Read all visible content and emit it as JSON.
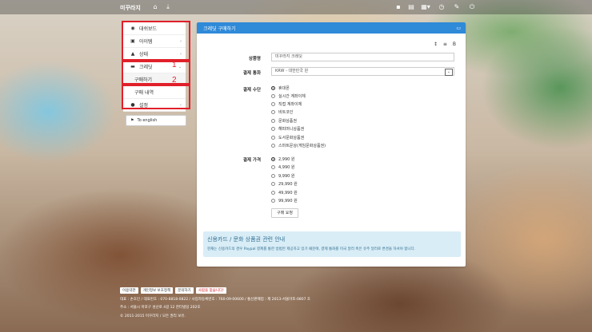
{
  "navbar": {
    "brand": "미꾸라지",
    "icons_left": [
      "home-icon",
      "download-icon"
    ],
    "icons_right": [
      "chat-icon",
      "document-icon",
      "grid-menu-icon",
      "clock-icon",
      "pencil-icon",
      "power-icon"
    ]
  },
  "sidebar": {
    "items": [
      {
        "icon": "dashboard-icon",
        "label": "대쉬보드"
      },
      {
        "icon": "item-icon",
        "label": "아이템",
        "chev": "‹"
      },
      {
        "icon": "status-icon",
        "label": "상태",
        "chev": "‹"
      },
      {
        "icon": "credit-icon",
        "label": "크레딧",
        "chev": "⌄"
      },
      {
        "label": "구매하기"
      },
      {
        "label": "구매 내역"
      },
      {
        "icon": "user-icon",
        "label": "설정",
        "chev": "‹"
      }
    ],
    "annotations": [
      "1",
      "2"
    ],
    "lang_button": "To english"
  },
  "panel": {
    "title": "크레딧 구매하기",
    "toolbar": [
      "↕",
      "≡",
      "B"
    ],
    "form": {
      "product_label": "상품명",
      "product_value": "미꾸라지 크레딧",
      "currency_label": "결제 통화",
      "currency_value": "KRW - 대한민국 원",
      "method_label": "결제 수단",
      "methods": [
        "휴대폰",
        "실시간 계좌이체",
        "직접 계좌이체",
        "비트코인",
        "문화상품권",
        "해피머니상품권",
        "도서문화상품권",
        "스마트문상(게임문화상품권)"
      ],
      "selected_method": 0,
      "price_label": "결제 가격",
      "prices": [
        "2,990 원",
        "4,990 원",
        "9,990 원",
        "29,990 원",
        "49,990 원",
        "99,990 원"
      ],
      "selected_price": 0,
      "submit_label": "구매 요청"
    },
    "notice": {
      "title": "신용카드 / 문화 상품권 관련 안내",
      "body": "현재는 신용카드의 경우 Paypal 결제를 통한 방법만 제공하고 있기 때문에, 결제 통화를 미국 달러 혹은 유주 달러로 변경을 하셔야 합니다."
    }
  },
  "footer": {
    "links": [
      "이용약관",
      "개인정보 보호정책",
      "문의하기",
      "사람을 찾습니다!"
    ],
    "lines": [
      "대표 : 손호인 / 대표번호 : 070-8818-0822 / 사업자등록번호 : 760-09-00600 / 통신판매업 : 제 2013-서울마포-0807 호",
      "주소 : 서울시 마포구 성산로 4길 12 한터빌딩 202호",
      "© 2011-2015 미꾸라지 / 모든 권리 보유."
    ]
  }
}
